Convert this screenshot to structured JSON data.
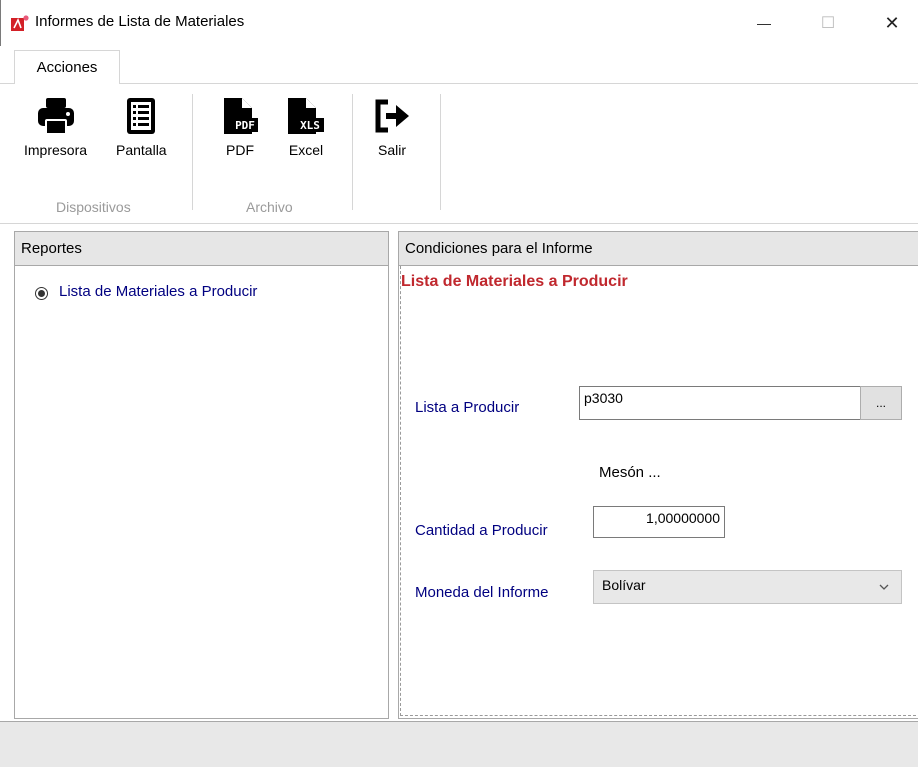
{
  "window": {
    "title": "Informes de Lista de Materiales",
    "minimize_glyph": "—",
    "maximize_glyph": "☐",
    "close_glyph": "✕"
  },
  "ribbon": {
    "tab": "Acciones",
    "buttons": {
      "printer": "Impresora",
      "screen": "Pantalla",
      "pdf": "PDF",
      "excel": "Excel",
      "exit": "Salir"
    },
    "groups": {
      "devices": "Dispositivos",
      "file": "Archivo"
    }
  },
  "reports_panel": {
    "header": "Reportes",
    "items": [
      {
        "label": "Lista de Materiales a Producir",
        "selected": true
      }
    ]
  },
  "conditions_panel": {
    "header": "Condiciones para el Informe",
    "title": "Lista de Materiales a Producir",
    "list_label": "Lista a Producir",
    "list_value": "p3030",
    "browse_label": "...",
    "list_description": "Mesón ...",
    "quantity_label": "Cantidad a Producir",
    "quantity_value": "1,00000000",
    "currency_label": "Moneda del Informe",
    "currency_value": "Bolívar"
  },
  "colors": {
    "accent_title": "#c0282e",
    "label_blue": "#000080"
  }
}
